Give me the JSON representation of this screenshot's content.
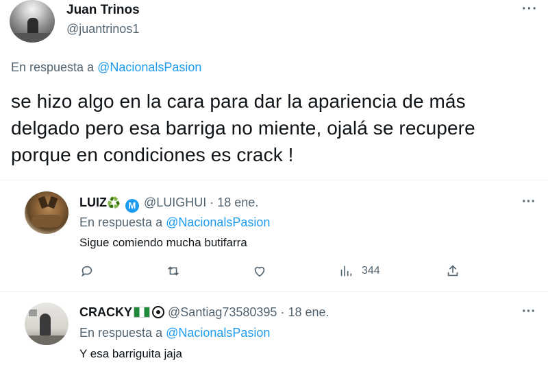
{
  "main_tweet": {
    "name": "Juan Trinos",
    "handle": "@juantrinos1",
    "reply_prefix": "En respuesta a ",
    "reply_mention": "@NacionalsPasion",
    "text": "se hizo algo en la cara para dar la apariencia de más delgado pero esa barriga no miente, ojalá se recupere porque en condiciones es crack !",
    "more_label": "···"
  },
  "replies": [
    {
      "name": "LUIZ",
      "name_emoji": "♻️",
      "verified_glyph": "M",
      "handle": "@LUIGHUI",
      "date": " · 18 ene.",
      "reply_prefix": "En respuesta a ",
      "reply_mention": "@NacionalsPasion",
      "text": "Sigue comiendo mucha butifarra",
      "more_label": "···",
      "views": "344",
      "icons": [
        "reply-icon",
        "retweet-icon",
        "like-icon",
        "views-icon",
        "share-icon"
      ]
    },
    {
      "name": "CRACKY",
      "handle": "@Santiag73580395",
      "date": " · 18 ene.",
      "reply_prefix": "En respuesta a ",
      "reply_mention": "@NacionalsPasion",
      "text": "Y esa barriguita jaja",
      "more_label": "···"
    }
  ],
  "colors": {
    "link": "#1d9bf0",
    "secondary_text": "#536471",
    "primary_text": "#0f1419",
    "divider": "#eff3f4"
  }
}
